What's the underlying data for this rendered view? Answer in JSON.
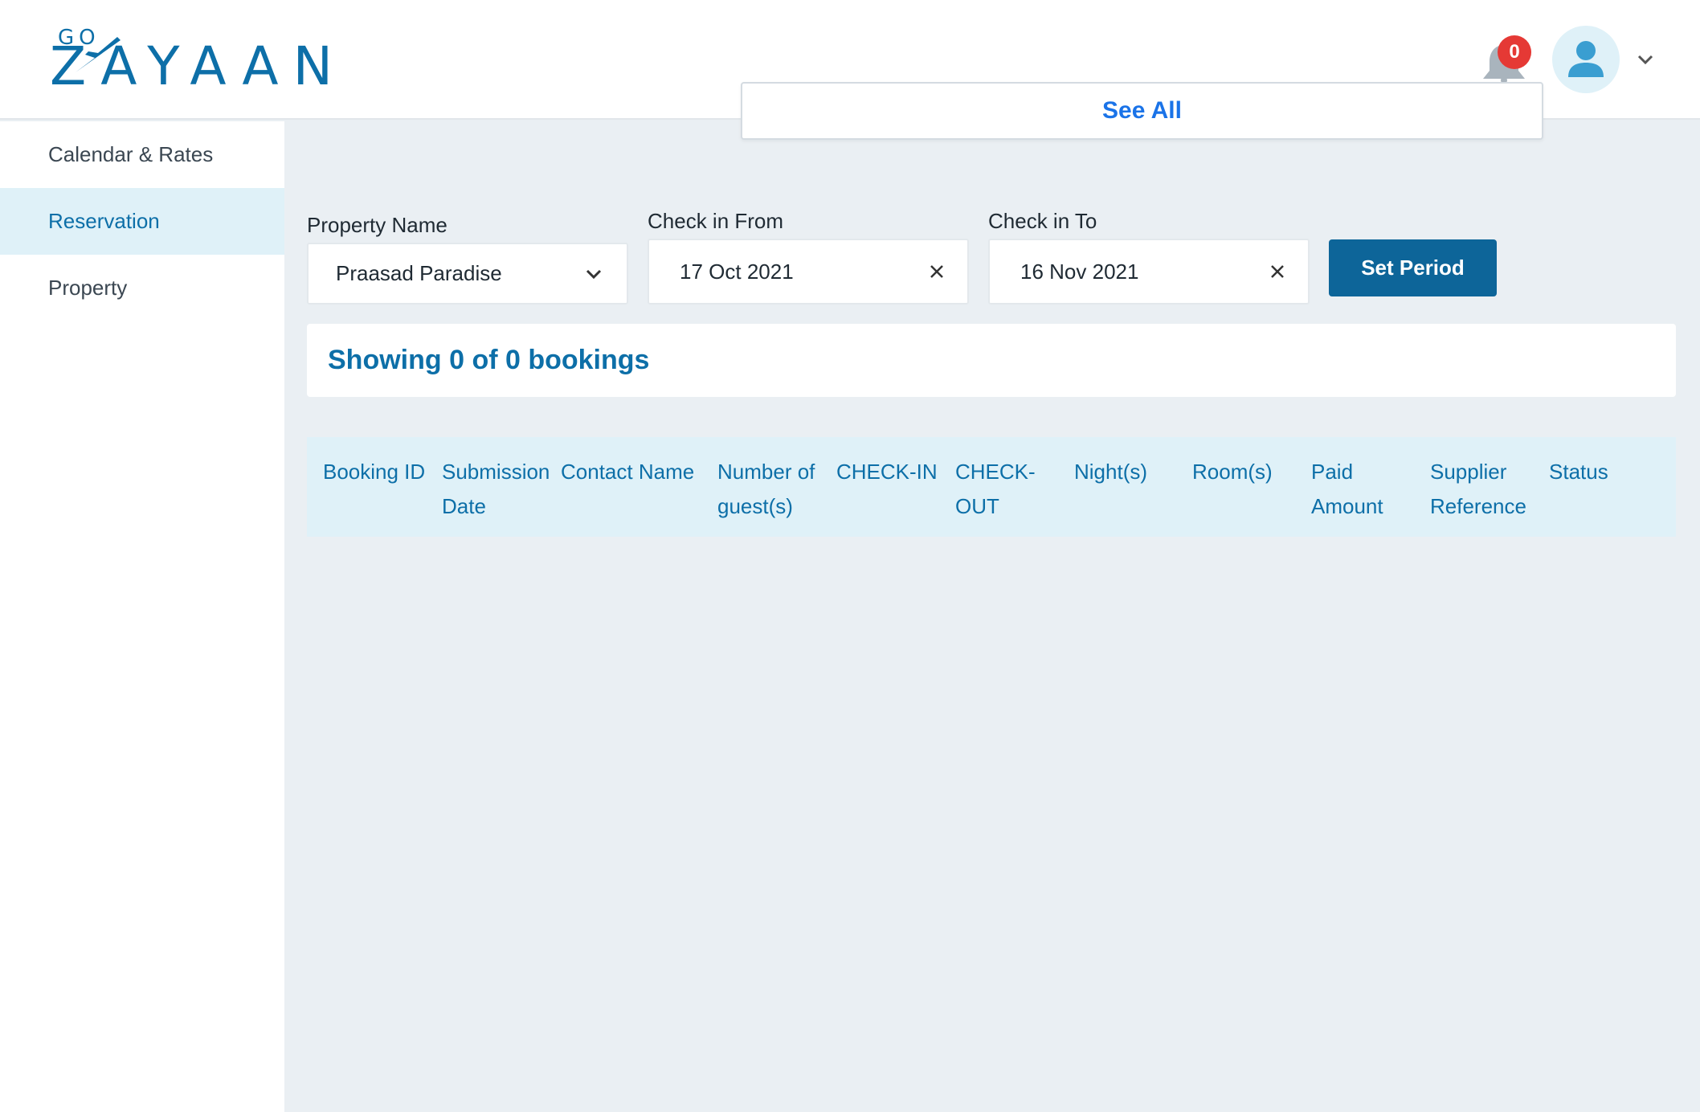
{
  "header": {
    "logo_prefix": "GO",
    "logo_text": "ZAYAAN",
    "notification_count": "0",
    "see_all": "See All"
  },
  "sidebar": {
    "items": [
      {
        "label": "Calendar & Rates",
        "active": false
      },
      {
        "label": "Reservation",
        "active": true
      },
      {
        "label": "Property",
        "active": false
      }
    ]
  },
  "filters": {
    "property_label": "Property Name",
    "property_value": "Praasad Paradise",
    "checkin_from_label": "Check in From",
    "checkin_from_value": "17 Oct 2021",
    "checkin_to_label": "Check in To",
    "checkin_to_value": "16 Nov 2021",
    "set_period": "Set Period"
  },
  "summary": "Showing 0 of 0 bookings",
  "table": {
    "columns": [
      "Booking ID",
      "Submission Date",
      "Contact Name",
      "Number of guest(s)",
      "CHECK-IN",
      "CHECK-OUT",
      "Night(s)",
      "Room(s)",
      "Paid Amount",
      "Supplier Reference",
      "Status"
    ]
  },
  "colors": {
    "brand": "#0d6fa8",
    "button": "#0d6599",
    "badge": "#e53935",
    "active_bg": "#dff1f8"
  }
}
